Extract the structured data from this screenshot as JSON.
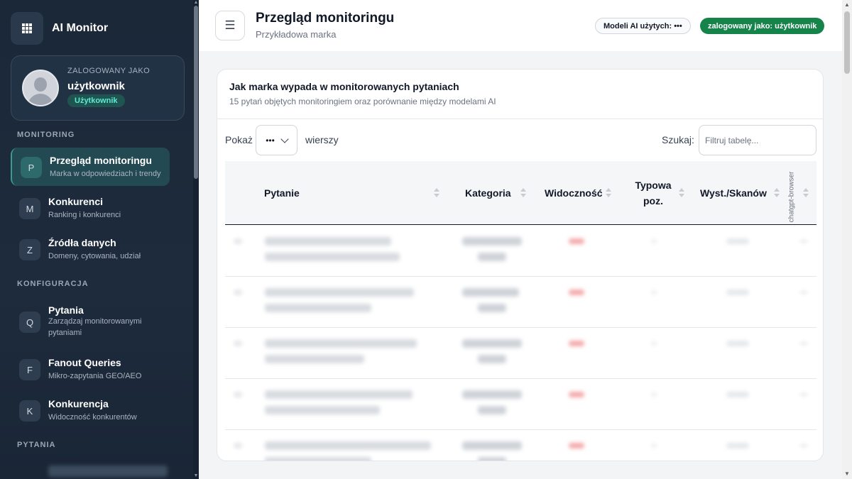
{
  "app": {
    "name": "AI Monitor"
  },
  "user_card": {
    "label": "ZALOGOWANY JAKO",
    "name": "użytkownik",
    "role": "Użytkownik"
  },
  "sidebar": {
    "sections": [
      {
        "title": "MONITORING",
        "items": [
          {
            "letter": "P",
            "title": "Przegląd monitoringu",
            "subtitle": "Marka w odpowiedziach i trendy",
            "active": true
          },
          {
            "letter": "M",
            "title": "Konkurenci",
            "subtitle": "Ranking i konkurenci"
          },
          {
            "letter": "Z",
            "title": "Źródła danych",
            "subtitle": "Domeny, cytowania, udział"
          }
        ]
      },
      {
        "title": "KONFIGURACJA",
        "items": [
          {
            "letter": "Q",
            "title": "Pytania",
            "subtitle": "Zarządzaj monitorowanymi pytaniami"
          },
          {
            "letter": "F",
            "title": "Fanout Queries",
            "subtitle": "Mikro-zapytania GEO/AEO"
          },
          {
            "letter": "K",
            "title": "Konkurencja",
            "subtitle": "Widoczność konkurentów"
          }
        ]
      },
      {
        "title": "PYTANIA",
        "items": []
      }
    ]
  },
  "header": {
    "title": "Przegląd monitoringu",
    "subtitle": "Przykładowa marka",
    "models_pill": "Modeli AI użytych: •••",
    "user_pill": "zalogowany jako: użytkownik"
  },
  "card": {
    "title": "Jak marka wypada w monitorowanych pytaniach",
    "subtitle": "15 pytań objętych monitoringiem oraz porównanie między modelami AI",
    "show_label": "Pokaż",
    "show_value": "•••",
    "rows_label": "wierszy",
    "search_label": "Szukaj:",
    "search_placeholder": "Filtruj tabelę..."
  },
  "table": {
    "columns": [
      "Pytanie",
      "Kategoria",
      "Widoczność",
      "Typowa poz.",
      "Wyst./Skanów",
      "chatgpt-browser"
    ]
  },
  "colors": {
    "sidebar_bg": "#1b2838",
    "accent_green": "#16844a",
    "active_item": "#234a52",
    "badge_teal": "#5eead4"
  }
}
